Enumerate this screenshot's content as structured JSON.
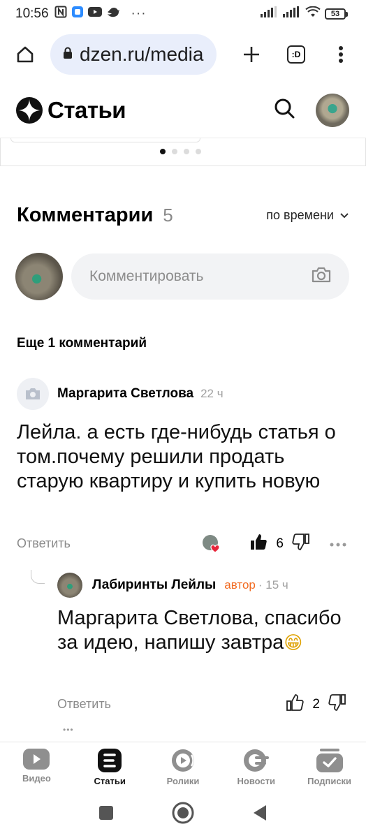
{
  "status_bar": {
    "time": "10:56",
    "dots": "···",
    "battery": "53"
  },
  "browser": {
    "url": "dzen.ru/media",
    "tab_count": ":D"
  },
  "site": {
    "logo": "Статьи"
  },
  "carousel": {
    "dots_total": 4,
    "active_index": 0
  },
  "comments": {
    "title": "Комментарии",
    "count": "5",
    "sort_label": "по времени",
    "composer_placeholder": "Комментировать",
    "more_comments": "Еще 1 комментарий",
    "items": [
      {
        "author": "Маргарита Светлова",
        "time": "22 ч",
        "text": "Лейла. а есть где-нибудь статья о том.почему решили продать старую квартиру и купить новую",
        "reply_label": "Ответить",
        "likes": "6"
      }
    ],
    "reply": {
      "author": "Лабиринты Лейлы",
      "badge": "автор",
      "time": "· 15 ч",
      "text": "Маргарита Светлова, спасибо за идею, напишу завтра",
      "emoji": "😁",
      "reply_label": "Ответить",
      "likes": "2",
      "more": "•••"
    }
  },
  "bottom_nav": {
    "items": [
      {
        "label": "Видео",
        "icon": "video-icon"
      },
      {
        "label": "Статьи",
        "icon": "articles-icon",
        "active": true
      },
      {
        "label": "Ролики",
        "icon": "shorts-icon"
      },
      {
        "label": "Новости",
        "icon": "news-icon"
      },
      {
        "label": "Подписки",
        "icon": "subscriptions-icon"
      }
    ]
  },
  "colors": {
    "accent_orange": "#f26b22",
    "url_bg": "#e9eefb",
    "muted": "#8b8b8b"
  }
}
